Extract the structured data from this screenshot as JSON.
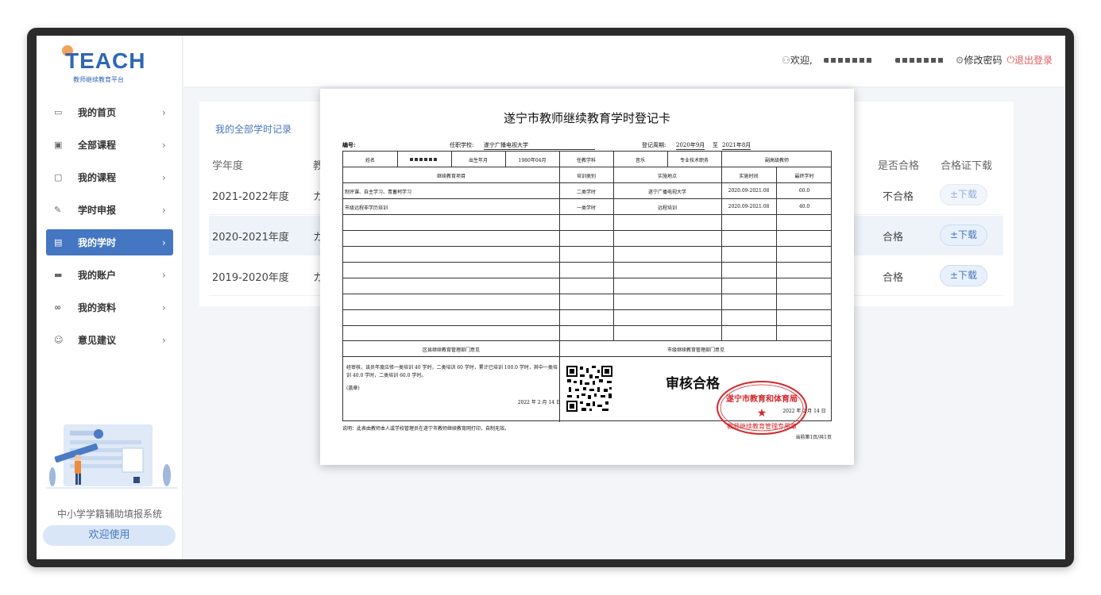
{
  "app": {
    "brand": "TEACH",
    "subtitle": "教师继续教育平台"
  },
  "nav": [
    {
      "label": "我的首页",
      "icon": "monitor-icon",
      "active": false
    },
    {
      "label": "全部课程",
      "icon": "book-icon",
      "active": false
    },
    {
      "label": "我的课程",
      "icon": "document-icon",
      "active": false
    },
    {
      "label": "学时申报",
      "icon": "pen-icon",
      "active": false
    },
    {
      "label": "我的学时",
      "icon": "file-icon",
      "active": true
    },
    {
      "label": "我的账户",
      "icon": "card-icon",
      "active": false
    },
    {
      "label": "我的资料",
      "icon": "link-icon",
      "active": false
    },
    {
      "label": "意见建议",
      "icon": "chat-icon",
      "active": false
    }
  ],
  "sidebar_footer": {
    "caption": "中小学学籍辅助填报系统",
    "button": "欢迎使用"
  },
  "topbar": {
    "welcome": "欢迎,",
    "change_password": "修改密码",
    "logout": "退出登录"
  },
  "records": {
    "title": "我的全部学时记录",
    "headers": {
      "year": "学年度",
      "col2": "教",
      "pass": "是否合格",
      "cert": "合格证下载"
    },
    "rows": [
      {
        "year": "2021-2022年度",
        "col2": "カ",
        "pass": "不合格",
        "download": "下载"
      },
      {
        "year": "2020-2021年度",
        "col2": "カ",
        "pass": "合格",
        "download": "下载"
      },
      {
        "year": "2019-2020年度",
        "col2": "カ",
        "pass": "合格",
        "download": "下载"
      }
    ]
  },
  "card": {
    "title": "遂宁市教师继续教育学时登记卡",
    "number_label": "编号:",
    "school_label": "任职学校:",
    "school": "遂宁广播电视大学",
    "period_label": "登记周期:",
    "period_from": "2020年9月",
    "period_to_label": "至",
    "period_to": "2021年8月",
    "info": {
      "name_label": "姓名",
      "birth_label": "出生年月",
      "birth": "1980年04月",
      "subject_label": "任教学科",
      "subject": "音乐",
      "title_label": "专业技术职务",
      "title": "副高级教师"
    },
    "table_headers": {
      "project": "继续教育项目",
      "type": "培训类别",
      "location": "实施地点",
      "time": "实施时间",
      "hours": "最终学时"
    },
    "items": [
      {
        "project": "制评课、自主学习、青蓄柯学习",
        "type": "二类学时",
        "location": "遂宁广播电视大学",
        "time": "2020.09-2021.08",
        "hours": "60.0"
      },
      {
        "project": "市级远程非学历培训",
        "type": "一类学时",
        "location": "远程培训",
        "time": "2020.09-2021.08",
        "hours": "40.0"
      }
    ],
    "district_opinion_label": "区县继续教育管理部门意见",
    "city_opinion_label": "市级继续教育管理部门意见",
    "district_opinion_text": "经审核，该员年度应修一类培训 40 学时，二类培训 60 学时，累计已培训 100.0 学时，其中一类培训 40.0 学时，二类培训 60.0 学时。",
    "seal_label": "(盖章)",
    "district_date": "2022 年 2 月 14 日",
    "approved_text": "审核合格",
    "stamp_text": "遂宁市教育和体育局",
    "stamp_sub": "教师继续教育管理专用章",
    "city_date": "2022 年 2 月 14 日",
    "note": "说明：此表由教师本人或学校管理员在遂宁市教师继续教育网打印，自制无效。",
    "page": "当前第1页/共1页"
  }
}
